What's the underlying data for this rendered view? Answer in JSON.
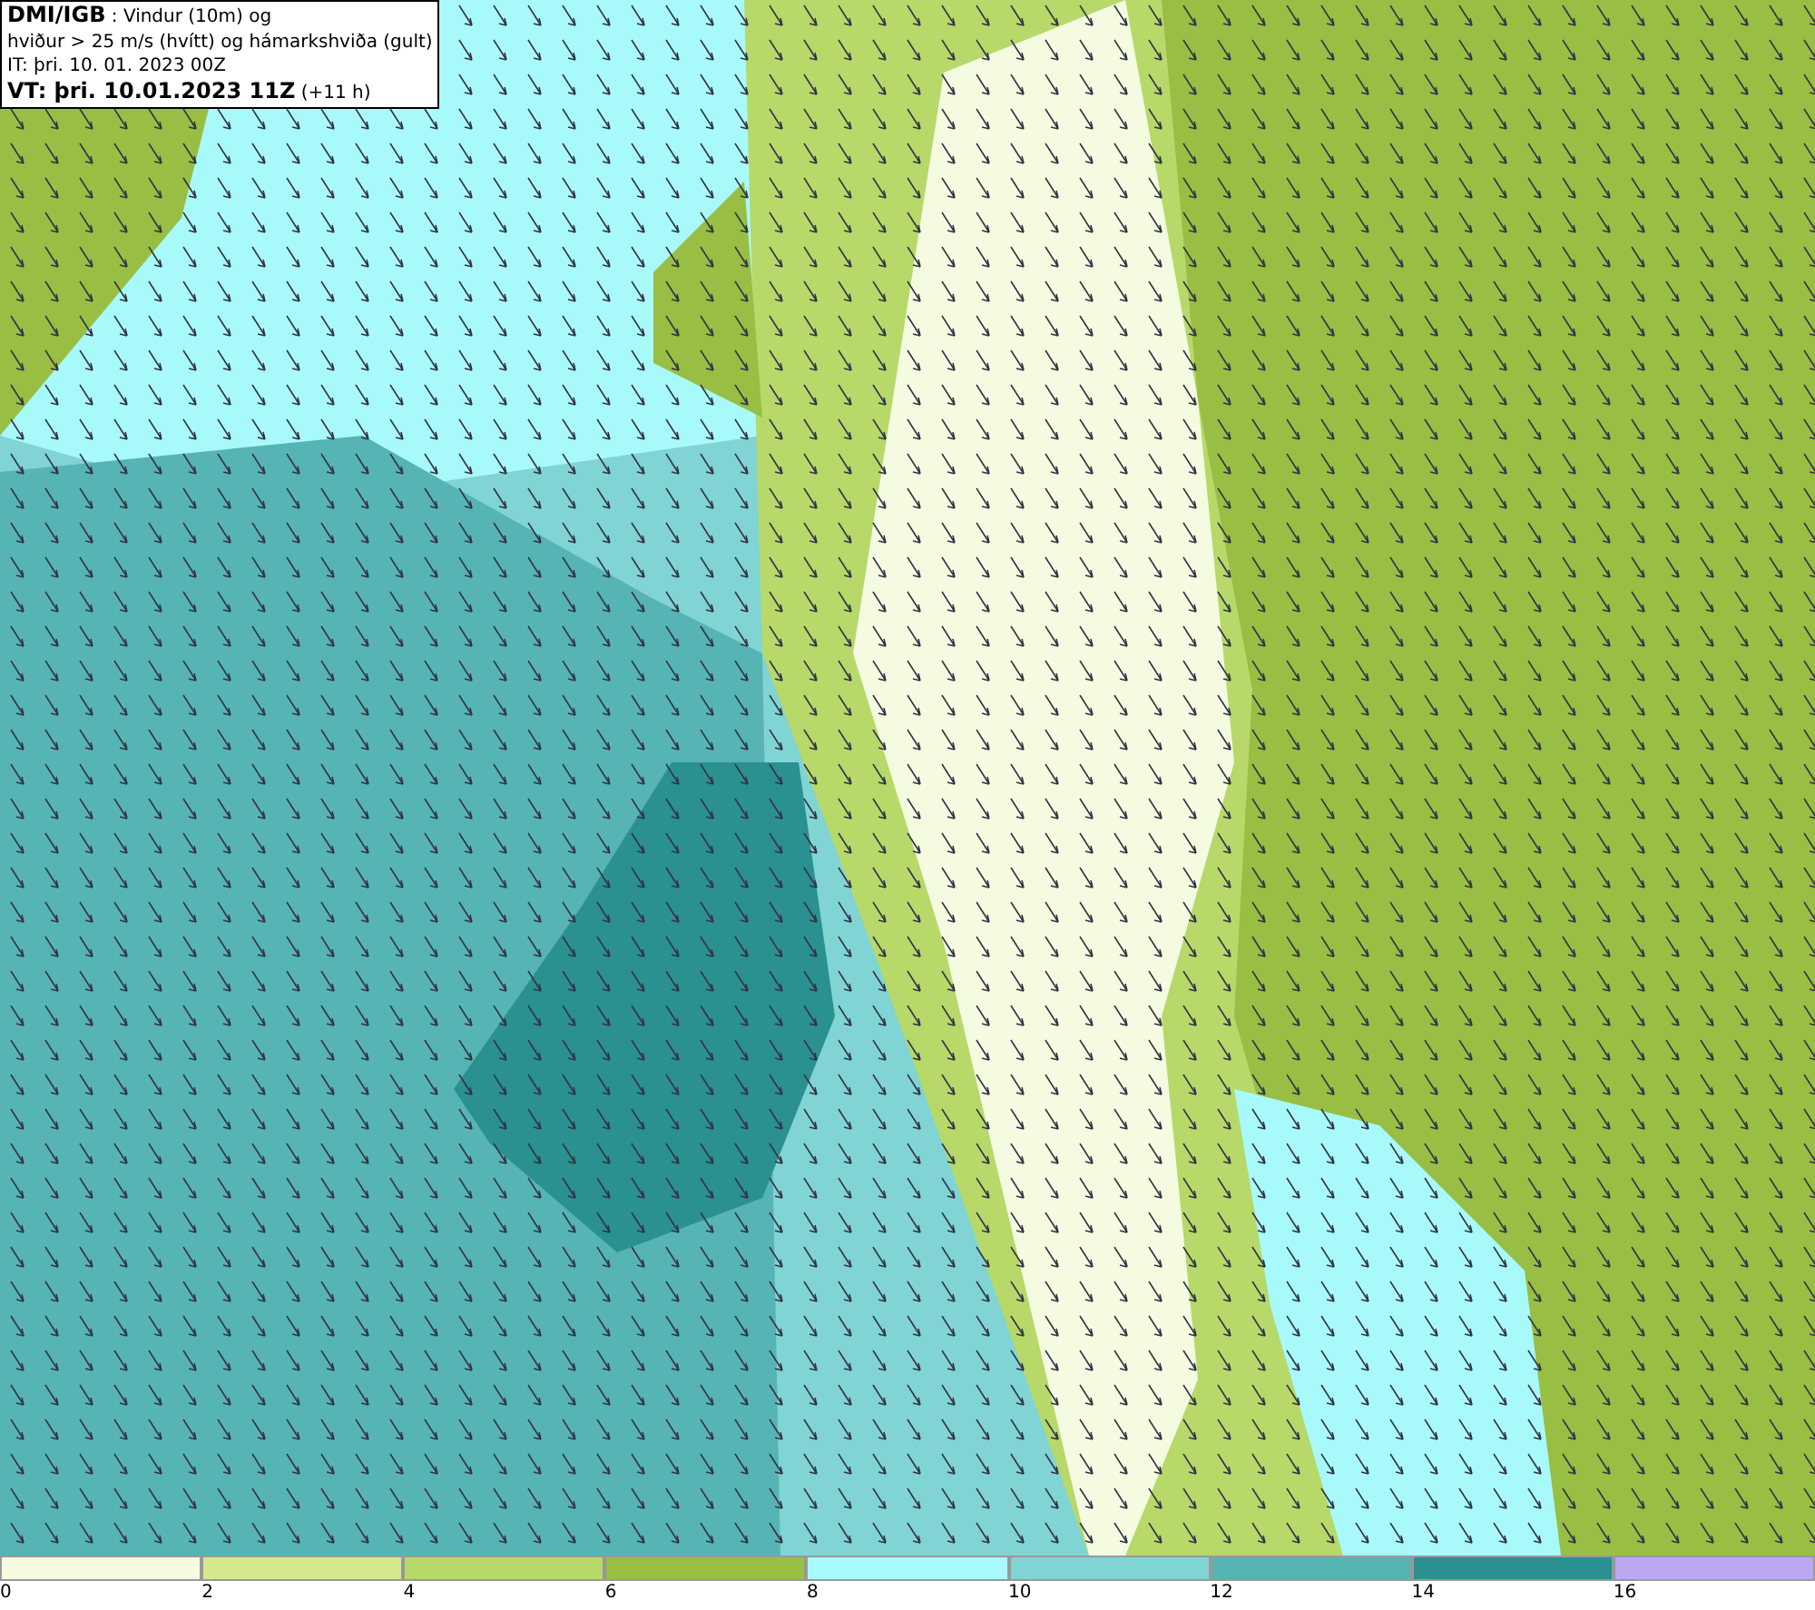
{
  "info_box": {
    "lines": [
      "**DMI/IGB** : Vindur (10m) og",
      "hviður > 25 m/s (hvítt) og hámarkshviða (gult)",
      "IT: þri. 10. 01. 2023 00Z",
      "**VT: þri. 10.01.2023 11Z** (+11 h)"
    ]
  },
  "colorbar": {
    "segments": [
      {
        "label": "0",
        "color": "#f4fbe0"
      },
      {
        "label": "2",
        "color": "#d4e98e"
      },
      {
        "label": "4",
        "color": "#b6d96a"
      },
      {
        "label": "6",
        "color": "#98be44"
      },
      {
        "label": "8",
        "color": "#a8fafa"
      },
      {
        "label": "10",
        "color": "#80d4d4"
      },
      {
        "label": "12",
        "color": "#56b4b4"
      },
      {
        "label": "14",
        "color": "#2a9090"
      },
      {
        "label": "16",
        "color": "#bca8f2"
      }
    ]
  }
}
